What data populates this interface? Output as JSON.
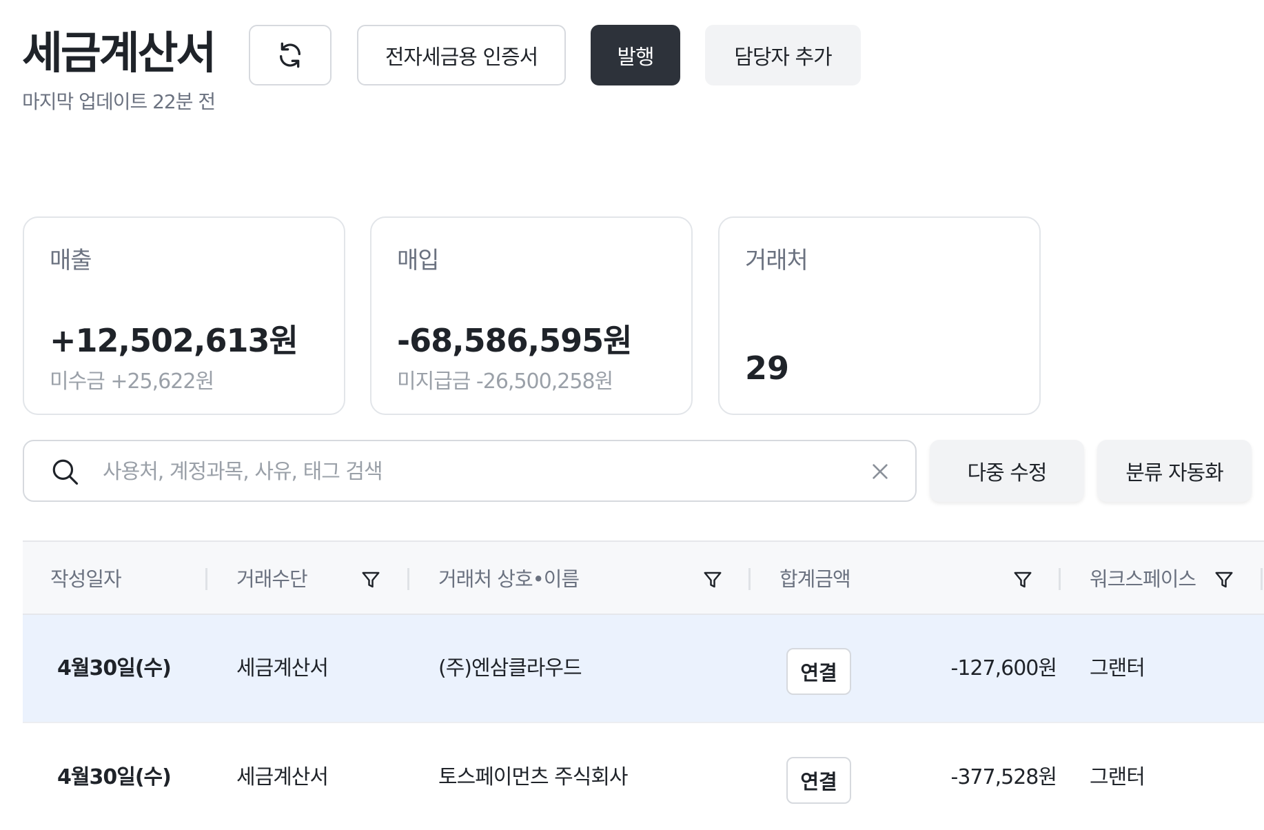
{
  "header": {
    "title": "세금계산서",
    "subtitle": "마지막 업데이트 22분 전",
    "refresh_icon": "refresh-icon",
    "cert_label": "전자세금용 인증서",
    "issue_label": "발행",
    "add_manager_label": "담당자 추가"
  },
  "summary": {
    "sales": {
      "label": "매출",
      "value": "+12,502,613원",
      "sub": "미수금 +25,622원"
    },
    "purchase": {
      "label": "매입",
      "value": "-68,586,595원",
      "sub": "미지급금 -26,500,258원"
    },
    "clients": {
      "label": "거래처",
      "value": "29"
    }
  },
  "search": {
    "placeholder": "사용처, 계정과목, 사유, 태그 검색",
    "value": "",
    "icon": "search-icon",
    "clear_icon": "close-icon"
  },
  "actions": {
    "multi_edit": "다중 수정",
    "auto_classify": "분류 자동화"
  },
  "table": {
    "columns": [
      "작성일자",
      "거래수단",
      "거래처 상호•이름",
      "합계금액",
      "워크스페이스"
    ],
    "rows": [
      {
        "date": "4월30일(수)",
        "method": "세금계산서",
        "vendor": "(주)엔삼클라우드",
        "link": "연결",
        "amount": "-127,600원",
        "workspace": "그랜터"
      },
      {
        "date": "4월30일(수)",
        "method": "세금계산서",
        "vendor": "토스페이먼츠 주식회사",
        "link": "연결",
        "amount": "-377,528원",
        "workspace": "그랜터"
      }
    ]
  },
  "colors": {
    "primary_dark": "#2d323a",
    "selected_row": "#ebf2fd",
    "muted_text": "#6b7280"
  }
}
